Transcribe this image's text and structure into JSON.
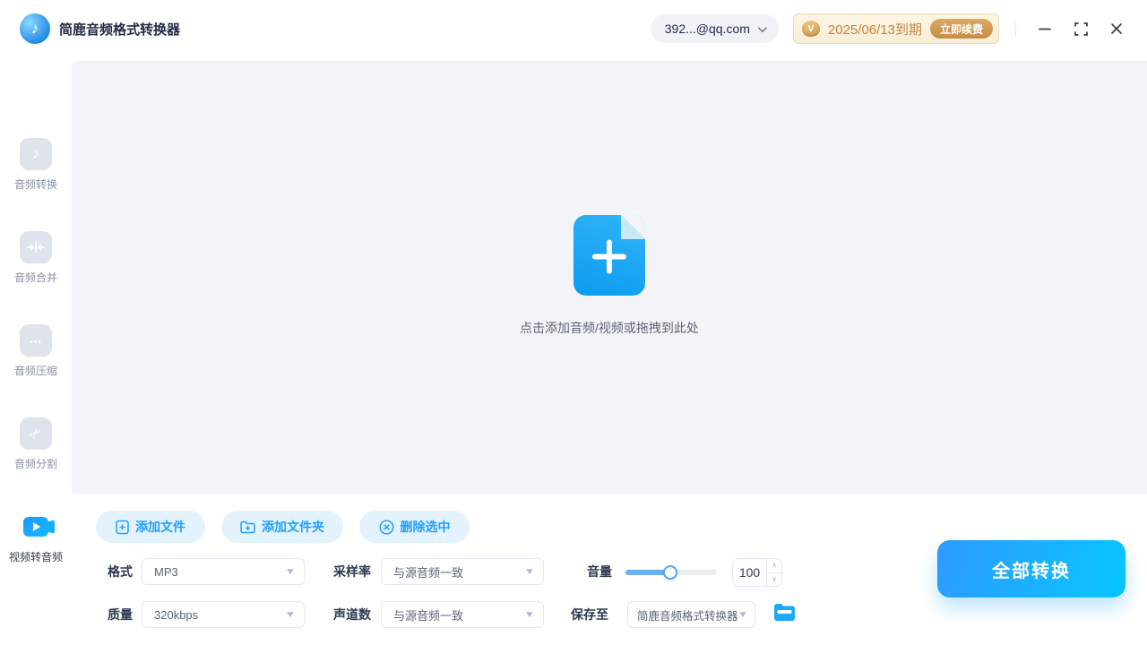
{
  "app": {
    "title": "简鹿音频格式转换器"
  },
  "topbar": {
    "account_label": "392...@qq.com",
    "vip_icon": "V",
    "vip_expiry": "2025/06/13到期",
    "vip_renew": "立即续费"
  },
  "sidebar": {
    "items": [
      {
        "label": "音频转换",
        "active": false
      },
      {
        "label": "音频合并",
        "active": false
      },
      {
        "label": "音频压缩",
        "active": false
      },
      {
        "label": "音频分割",
        "active": false
      },
      {
        "label": "视频转音频",
        "active": true
      }
    ]
  },
  "dropzone": {
    "hint": "点击添加音频/视频或拖拽到此处"
  },
  "toolbar": {
    "add_file": "添加文件",
    "add_folder": "添加文件夹",
    "delete_selected": "删除选中"
  },
  "settings": {
    "format": {
      "label": "格式",
      "value": "MP3"
    },
    "sample_rate": {
      "label": "采样率",
      "value": "与源音频一致"
    },
    "volume": {
      "label": "音量",
      "value": "100",
      "slider_percent": 50
    },
    "quality": {
      "label": "质量",
      "value": "320kbps"
    },
    "channels": {
      "label": "声道数",
      "value": "与源音频一致"
    },
    "save_to": {
      "label": "保存至",
      "value": "简鹿音频格式转换器"
    }
  },
  "actions": {
    "convert_all": "全部转换"
  },
  "colors": {
    "accent": "#1E9FFF",
    "accent_cyan": "#08C6FE",
    "gold_text": "#C1873E",
    "panel_bg": "#F3F4F7",
    "pill_bg": "#E2F3FE"
  }
}
